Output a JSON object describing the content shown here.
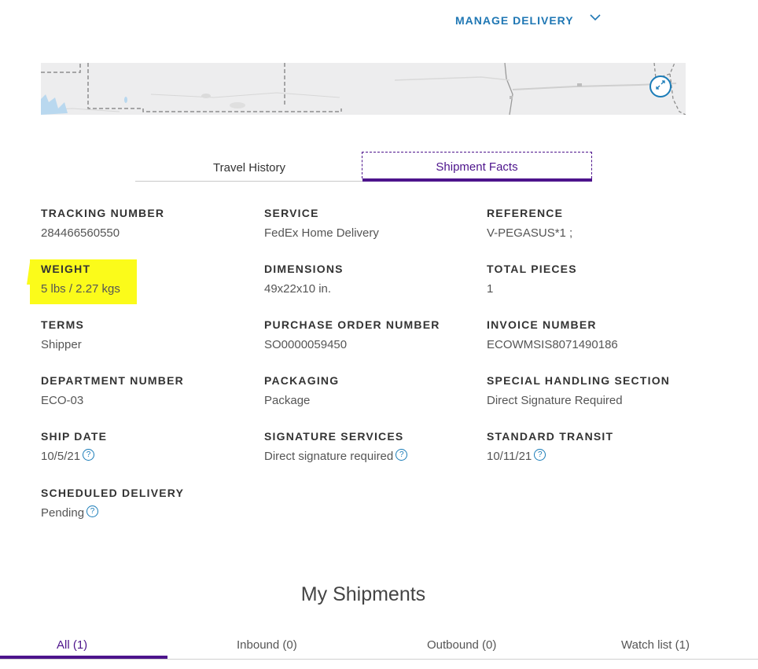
{
  "header": {
    "manage_delivery": "MANAGE DELIVERY"
  },
  "map": {
    "expand_icon": "expand-arrows-icon"
  },
  "tabs": {
    "travel_history": "Travel History",
    "shipment_facts": "Shipment Facts",
    "active": "Shipment Facts"
  },
  "facts": {
    "tracking_number": {
      "label": "TRACKING NUMBER",
      "value": "284466560550"
    },
    "service": {
      "label": "SERVICE",
      "value": "FedEx Home Delivery"
    },
    "reference": {
      "label": "REFERENCE",
      "value": "V-PEGASUS*1 ;"
    },
    "weight": {
      "label": "WEIGHT",
      "value": "5 lbs / 2.27 kgs"
    },
    "dimensions": {
      "label": "DIMENSIONS",
      "value": "49x22x10 in."
    },
    "total_pieces": {
      "label": "TOTAL PIECES",
      "value": "1"
    },
    "terms": {
      "label": "TERMS",
      "value": "Shipper"
    },
    "purchase_order_number": {
      "label": "PURCHASE ORDER NUMBER",
      "value": "SO0000059450"
    },
    "invoice_number": {
      "label": "INVOICE NUMBER",
      "value": "ECOWMSIS8071490186"
    },
    "department_number": {
      "label": "DEPARTMENT NUMBER",
      "value": "ECO-03"
    },
    "packaging": {
      "label": "PACKAGING",
      "value": "Package"
    },
    "special_handling_section": {
      "label": "SPECIAL HANDLING SECTION",
      "value": "Direct Signature Required"
    },
    "ship_date": {
      "label": "SHIP DATE",
      "value": "10/5/21"
    },
    "signature_services": {
      "label": "SIGNATURE SERVICES",
      "value": "Direct signature required"
    },
    "standard_transit": {
      "label": "STANDARD TRANSIT",
      "value": "10/11/21"
    },
    "scheduled_delivery": {
      "label": "SCHEDULED DELIVERY",
      "value": "Pending"
    }
  },
  "highlight_color": "#fbfb1a",
  "accent_color": "#4d148c",
  "link_color": "#1f77b4",
  "my_shipments": {
    "title": "My Shipments",
    "tabs": [
      "All (1)",
      "Inbound (0)",
      "Outbound (0)",
      "Watch list (1)"
    ],
    "active": "All (1)"
  }
}
